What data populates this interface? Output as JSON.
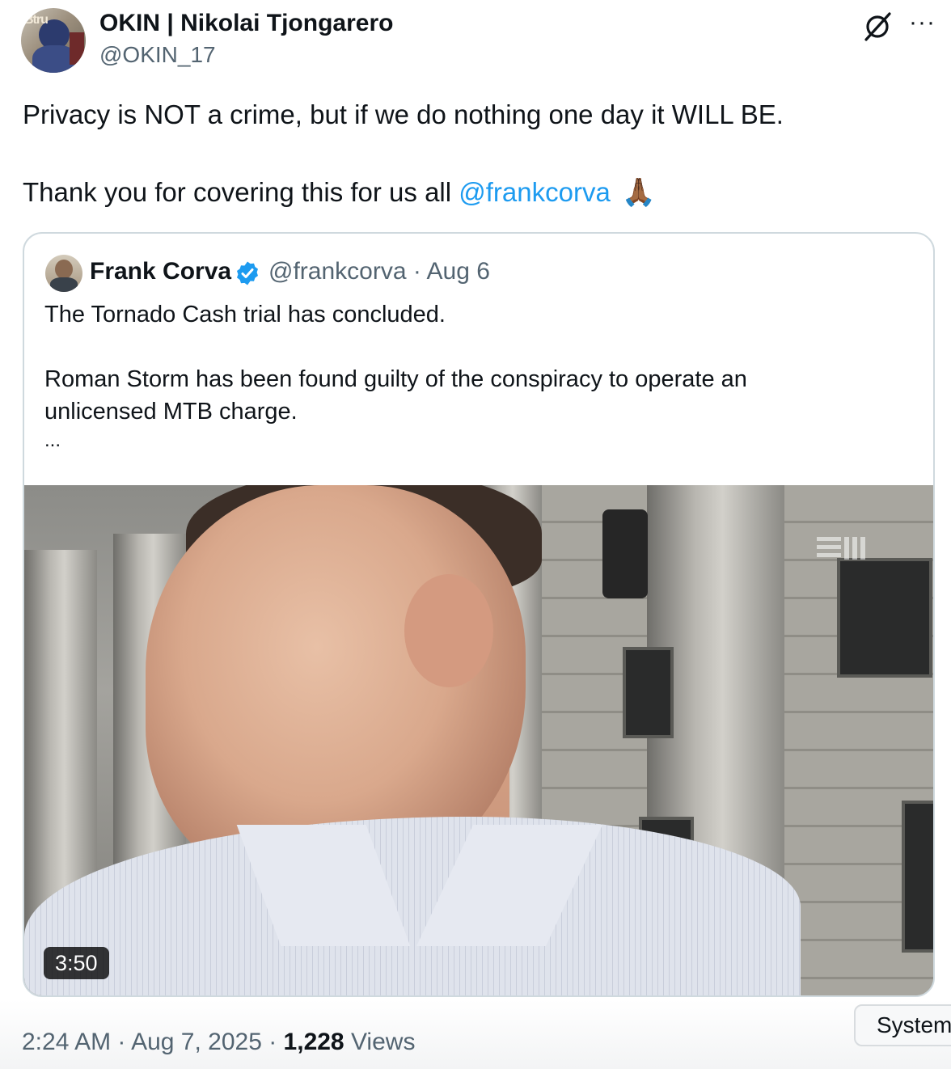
{
  "author": {
    "display_name": "OKIN | Nikolai Tjongarero",
    "handle": "@OKIN_17"
  },
  "header_icons": {
    "grok": "grok-icon",
    "more": "more-horizontal-icon",
    "more_glyph": "···"
  },
  "tweet": {
    "line1": "Privacy is NOT a crime, but if we do nothing one day it WILL BE.",
    "line2_text": "Thank you for covering this for us all ",
    "line2_mention": "@frankcorva",
    "emoji": "🙏🏾"
  },
  "quote": {
    "name": "Frank Corva",
    "handle_date": "@frankcorva · Aug 6",
    "text_line1": "The Tornado Cash trial has concluded.",
    "text_line2": "Roman Storm has been found guilty of the conspiracy to operate an",
    "text_line3": "unlicensed MTB charge.",
    "ellipsis": "...",
    "video_duration": "3:50"
  },
  "meta": {
    "time_date": "2:24 AM · Aug 7, 2025 · ",
    "views_count": "1,228",
    "views_label": " Views"
  },
  "system_pill": "System",
  "colors": {
    "accent": "#1d9bf0",
    "muted": "#536471",
    "text": "#0f1419",
    "border": "#cfd9de"
  }
}
